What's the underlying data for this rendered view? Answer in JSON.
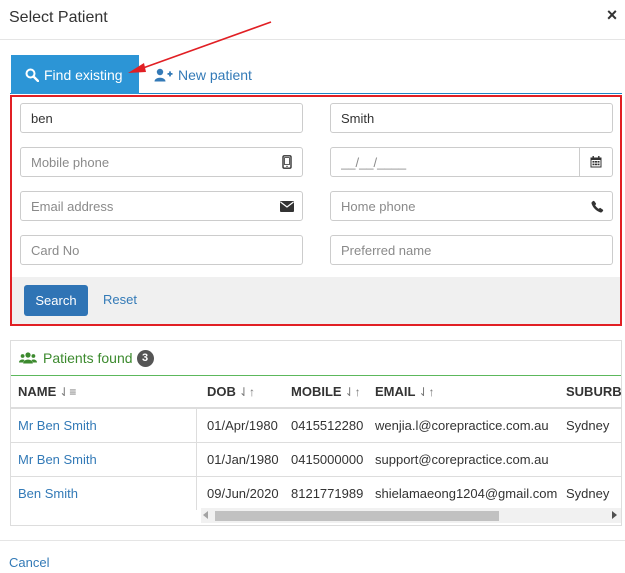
{
  "modal": {
    "title": "Select Patient",
    "close_glyph": "×"
  },
  "tabs": [
    {
      "label": "Find existing",
      "icon": "search-icon",
      "active": true
    },
    {
      "label": "New patient",
      "icon": "add-user-icon",
      "active": false
    }
  ],
  "form": {
    "first_name": {
      "value": "ben",
      "placeholder": ""
    },
    "last_name": {
      "value": "Smith",
      "placeholder": ""
    },
    "mobile": {
      "value": "",
      "placeholder": "Mobile phone",
      "icon": "mobile-phone-icon"
    },
    "dob": {
      "value": "",
      "placeholder": "__/__/____",
      "icon": "calendar-icon"
    },
    "email": {
      "value": "",
      "placeholder": "Email address",
      "icon": "envelope-icon"
    },
    "home_phone": {
      "value": "",
      "placeholder": "Home phone",
      "icon": "phone-icon"
    },
    "card_no": {
      "value": "",
      "placeholder": "Card No"
    },
    "preferred_name": {
      "value": "",
      "placeholder": "Preferred name"
    },
    "search_label": "Search",
    "reset_label": "Reset"
  },
  "results": {
    "heading": "Patients found",
    "count": "3",
    "icon": "users-icon",
    "columns": [
      {
        "label": "NAME",
        "sort_glyph": "⇃≡"
      },
      {
        "label": "DOB",
        "sort_glyph": "⇃↑"
      },
      {
        "label": "MOBILE",
        "sort_glyph": "⇃↑"
      },
      {
        "label": "EMAIL",
        "sort_glyph": "⇃↑"
      },
      {
        "label": "SUBURB",
        "sort_glyph": ""
      }
    ],
    "rows": [
      {
        "name": "Mr Ben Smith",
        "dob": "01/Apr/1980",
        "mobile": "0415512280",
        "email": "wenjia.l@corepractice.com.au",
        "suburb": "Sydney"
      },
      {
        "name": "Mr Ben Smith",
        "dob": "01/Jan/1980",
        "mobile": "0415000000",
        "email": "support@corepractice.com.au",
        "suburb": ""
      },
      {
        "name": "Ben Smith",
        "dob": "09/Jun/2020",
        "mobile": "8121771989",
        "email": "shielamaeong1204@gmail.com",
        "suburb": "Sydney"
      }
    ]
  },
  "footer": {
    "cancel_label": "Cancel"
  },
  "colors": {
    "accent_blue": "#2c95d6",
    "link_blue": "#337ab7",
    "button_blue": "#2f74b5",
    "success_green": "#3c8a2e",
    "annotation_red": "#e11f24"
  }
}
